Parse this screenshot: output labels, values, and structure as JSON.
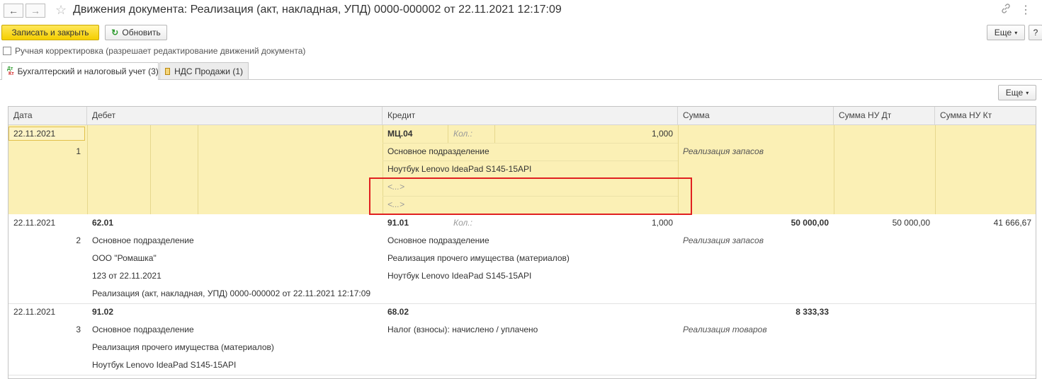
{
  "window": {
    "title": "Движения документа: Реализация (акт, накладная, УПД) 0000-000002 от 22.11.2021 12:17:09",
    "back": "←",
    "forward": "→",
    "star": "☆",
    "link_icon": "🔗",
    "menu_icon": "⋮",
    "close": "×"
  },
  "toolbar": {
    "save_close": "Записать и закрыть",
    "refresh": "Обновить",
    "more": "Еще",
    "help": "?"
  },
  "manual_correction": {
    "label": "Ручная корректировка (разрешает редактирование движений документа)",
    "checked": false
  },
  "tabs": [
    {
      "label": "Бухгалтерский и налоговый учет (3)",
      "icon": "dt-kt-icon",
      "active": true
    },
    {
      "label": "НДС Продажи (1)",
      "icon": "register-icon",
      "active": false
    }
  ],
  "grid": {
    "more": "Еще",
    "columns": [
      "Дата",
      "Дебет",
      "Кредит",
      "Сумма",
      "Сумма НУ Дт",
      "Сумма НУ Кт"
    ],
    "qty_label": "Кол.:",
    "rows": [
      {
        "date": "22.11.2021",
        "num": "1",
        "debit": {
          "account": "",
          "lines": [
            "",
            "",
            "",
            ""
          ]
        },
        "credit": {
          "account": "МЦ.04",
          "qty": "1,000",
          "lines": [
            "Основное подразделение",
            "Ноутбук Lenovo IdeaPad S145-15API",
            "<...>",
            "<...>"
          ]
        },
        "sum": "",
        "content": "Реализация запасов",
        "nu_dt": "",
        "nu_kt": ""
      },
      {
        "date": "22.11.2021",
        "num": "2",
        "debit": {
          "account": "62.01",
          "lines": [
            "Основное подразделение",
            "ООО \"Ромашка\"",
            "123 от 22.11.2021",
            "Реализация (акт, накладная, УПД) 0000-000002 от 22.11.2021 12:17:09"
          ]
        },
        "credit": {
          "account": "91.01",
          "qty": "1,000",
          "lines": [
            "Основное подразделение",
            "Реализация прочего имущества (материалов)",
            "Ноутбук Lenovo IdeaPad S145-15API"
          ]
        },
        "sum": "50 000,00",
        "content": "Реализация запасов",
        "nu_dt": "50 000,00",
        "nu_kt": "41 666,67"
      },
      {
        "date": "22.11.2021",
        "num": "3",
        "debit": {
          "account": "91.02",
          "lines": [
            "Основное подразделение",
            "Реализация прочего имущества (материалов)",
            "Ноутбук Lenovo IdeaPad S145-15API"
          ]
        },
        "credit": {
          "account": "68.02",
          "lines": [
            "Налог (взносы): начислено / уплачено"
          ]
        },
        "sum": "8 333,33",
        "content": "Реализация товаров",
        "nu_dt": "",
        "nu_kt": ""
      }
    ]
  }
}
